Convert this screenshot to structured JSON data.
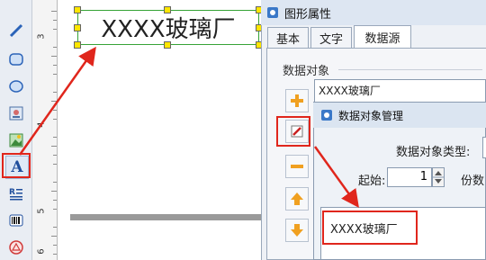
{
  "canvas": {
    "label_text": "XXXX玻璃厂"
  },
  "ruler": {
    "numbers": [
      "3",
      "4",
      "5",
      "6"
    ]
  },
  "toolbar": {
    "tools": [
      "line-tool-icon",
      "rounded-rect-tool-icon",
      "ellipse-tool-icon",
      "image-tool-icon",
      "picture-tool-icon",
      "text-tool-icon",
      "rtf-text-tool-icon",
      "barcode-tool-icon",
      "shape-tool-icon"
    ],
    "text_tool_glyph": "A"
  },
  "props_window": {
    "title": "图形属性",
    "tabs": [
      "基本",
      "文字",
      "数据源"
    ],
    "group_label": "数据对象",
    "list_item": "XXXX玻璃厂"
  },
  "dialog": {
    "title": "数据对象管理",
    "type_label": "数据对象类型:",
    "start_label": "起始:",
    "start_value": "1",
    "copies_label": "份数",
    "content_value": "XXXX玻璃厂"
  },
  "colors": {
    "highlight": "#e0261c",
    "selection": "#36a336",
    "handle": "#ffe600"
  }
}
